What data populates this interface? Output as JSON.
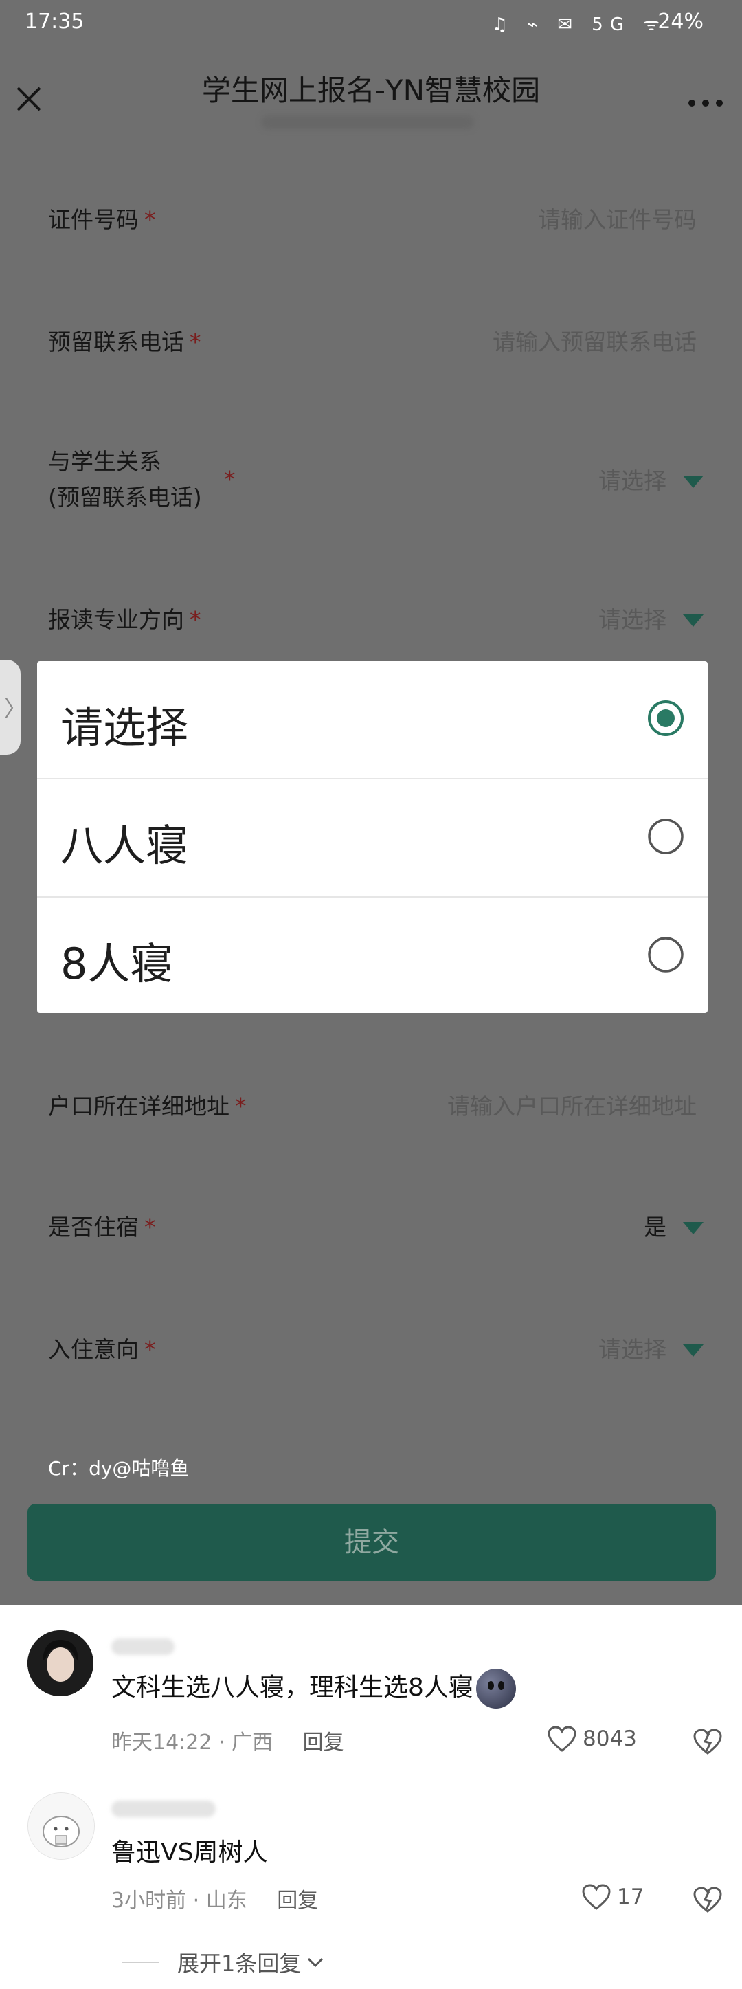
{
  "status_bar": {
    "time": "17:35",
    "icons": "♫ ⌁ ✉ 5G ᯤ",
    "battery": "24%"
  },
  "header": {
    "title": "学生网上报名-YN智慧校园"
  },
  "form": {
    "fields": [
      {
        "label": "证件号码",
        "required": "*",
        "value": "请输入证件号码"
      },
      {
        "label": "预留联系电话",
        "required": "*",
        "value": "请输入预留联系电话"
      },
      {
        "label_line1": "与学生关系",
        "label_line2": "(预留联系电话)",
        "required": "*",
        "value": "请选择"
      },
      {
        "label": "报读专业方向",
        "required": "*",
        "value": "请选择"
      },
      {
        "label": "户口所在详细地址",
        "required": "*",
        "value": "请输入户口所在详细地址"
      },
      {
        "label": "是否住宿",
        "required": "*",
        "value": "是"
      },
      {
        "label": "入住意向",
        "required": "*",
        "value": "请选择"
      }
    ],
    "submit_label": "提交"
  },
  "dropdown": {
    "options": [
      {
        "label": "请选择",
        "selected": true
      },
      {
        "label": "八人寝",
        "selected": false
      },
      {
        "label": "8人寝",
        "selected": false
      }
    ]
  },
  "side_tab": {
    "glyph": "〉"
  },
  "watermark": "Cr：dy@咕噜鱼",
  "comments": [
    {
      "text": "文科生选八人寝，理科生选8人寝",
      "time": "昨天14:22",
      "separator": "·",
      "location": "广西",
      "reply_label": "回复",
      "likes": "8043"
    },
    {
      "text": "鲁迅VS周树人",
      "time": "3小时前",
      "separator": "·",
      "location": "山东",
      "reply_label": "回复",
      "likes": "17",
      "expand_label": "展开1条回复"
    }
  ],
  "colors": {
    "overlay_bg": "#6f6f6f",
    "accent_green": "#2a7a64",
    "submit_bg": "#1f5a4c",
    "required_red": "#7a1d1d"
  }
}
